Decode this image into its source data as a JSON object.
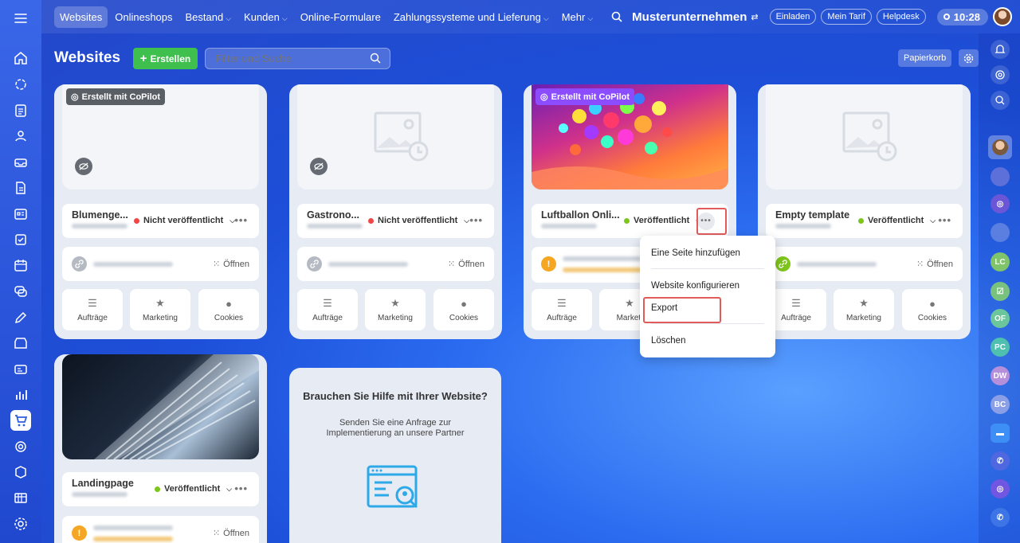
{
  "topbar": {
    "nav": [
      {
        "label": "Websites",
        "active": true,
        "caret": false
      },
      {
        "label": "Onlineshops",
        "caret": false
      },
      {
        "label": "Bestand",
        "caret": true
      },
      {
        "label": "Kunden",
        "caret": true
      },
      {
        "label": "Online-Formulare",
        "caret": false
      },
      {
        "label": "Zahlungssysteme und Lieferung",
        "caret": true
      },
      {
        "label": "Mehr",
        "caret": true
      }
    ],
    "company": "Musterunternehmen",
    "invite": "Einladen",
    "tariff": "Mein Tarif",
    "helpdesk": "Helpdesk",
    "time": "10:28"
  },
  "page": {
    "title": "Websites",
    "create": "Erstellen",
    "search_placeholder": "Filter und Suche",
    "trash": "Papierkorb"
  },
  "cards": [
    {
      "badge": "Erstellt mit CoPilot",
      "name": "Blumenge...",
      "status": "Nicht veröffentlicht",
      "status_color": "#f04646",
      "open": "Öffnen"
    },
    {
      "name": "Gastrono...",
      "status": "Nicht veröffentlicht",
      "status_color": "#f04646",
      "open": "Öffnen"
    },
    {
      "badge": "Erstellt mit CoPilot",
      "name": "Luftballon Onli...",
      "status": "Veröffentlicht",
      "status_color": "#7ec51b"
    },
    {
      "name": "Empty template",
      "status": "Veröffentlicht",
      "status_color": "#7ec51b",
      "open": "Öffnen"
    },
    {
      "name": "Landingpage",
      "status": "Veröffentlicht",
      "status_color": "#7ec51b",
      "open": "Öffnen"
    }
  ],
  "tiles": {
    "orders": "Aufträge",
    "marketing": "Marketing",
    "cookies": "Cookies",
    "marketing_cut": "Marketi"
  },
  "menu": {
    "items": [
      "Eine Seite hinzufügen",
      "Website konfigurieren",
      "Export",
      "Löschen"
    ]
  },
  "help": {
    "title": "Brauchen Sie Hilfe mit Ihrer Website?",
    "text": "Senden Sie eine Anfrage zur Implementierung an unsere Partner"
  },
  "rightbar": {
    "initials": [
      "LC",
      "OF",
      "PC",
      "DW",
      "BC"
    ]
  }
}
